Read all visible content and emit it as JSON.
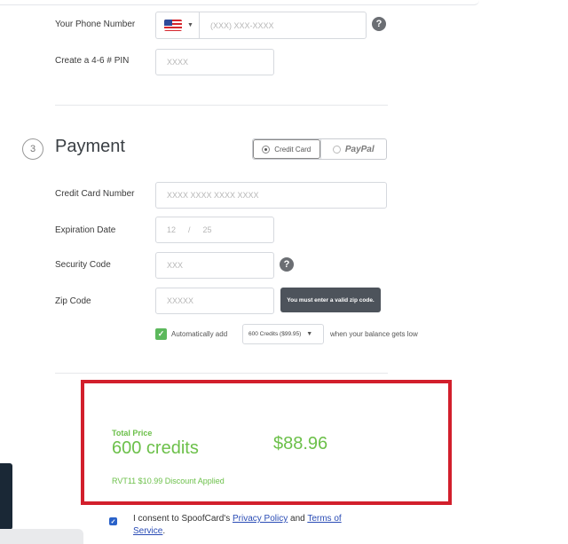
{
  "phone": {
    "label": "Your Phone Number",
    "country_flag": "us-flag-icon",
    "placeholder": "(XXX) XXX-XXXX"
  },
  "pin": {
    "label": "Create a 4-6 # PIN",
    "placeholder": "XXXX"
  },
  "payment": {
    "step_number": "3",
    "title": "Payment",
    "methods": [
      {
        "label": "Credit Card",
        "selected": true
      },
      {
        "label": "PayPal",
        "selected": false
      }
    ],
    "card_number": {
      "label": "Credit Card Number",
      "placeholder": "XXXX XXXX XXXX XXXX"
    },
    "expiration": {
      "label": "Expiration Date",
      "month": "12",
      "separator": "/",
      "year": "25"
    },
    "security_code": {
      "label": "Security Code",
      "placeholder": "XXX"
    },
    "zip_code": {
      "label": "Zip Code",
      "placeholder": "XXXXX",
      "error_tooltip": "You must enter a valid zip code."
    },
    "auto_add": {
      "checked": true,
      "prefix": "Automatically add",
      "selected_option": "600 Credits ($99.95)",
      "suffix": "when your balance gets low"
    }
  },
  "total": {
    "label": "Total Price",
    "credits": "600 credits",
    "price": "$88.96",
    "discount": "RVT11 $10.99 Discount Applied"
  },
  "consent": {
    "checked": true,
    "text_before": "I consent to SpoofCard's",
    "privacy_link": "Privacy Policy",
    "and": "and",
    "terms_link": "Terms of Service",
    "period": "."
  },
  "colors": {
    "accent_green": "#6cc04a",
    "highlight_red": "#d21f2c",
    "tooltip_bg": "#4d535b",
    "link_blue": "#2a4cb5"
  }
}
